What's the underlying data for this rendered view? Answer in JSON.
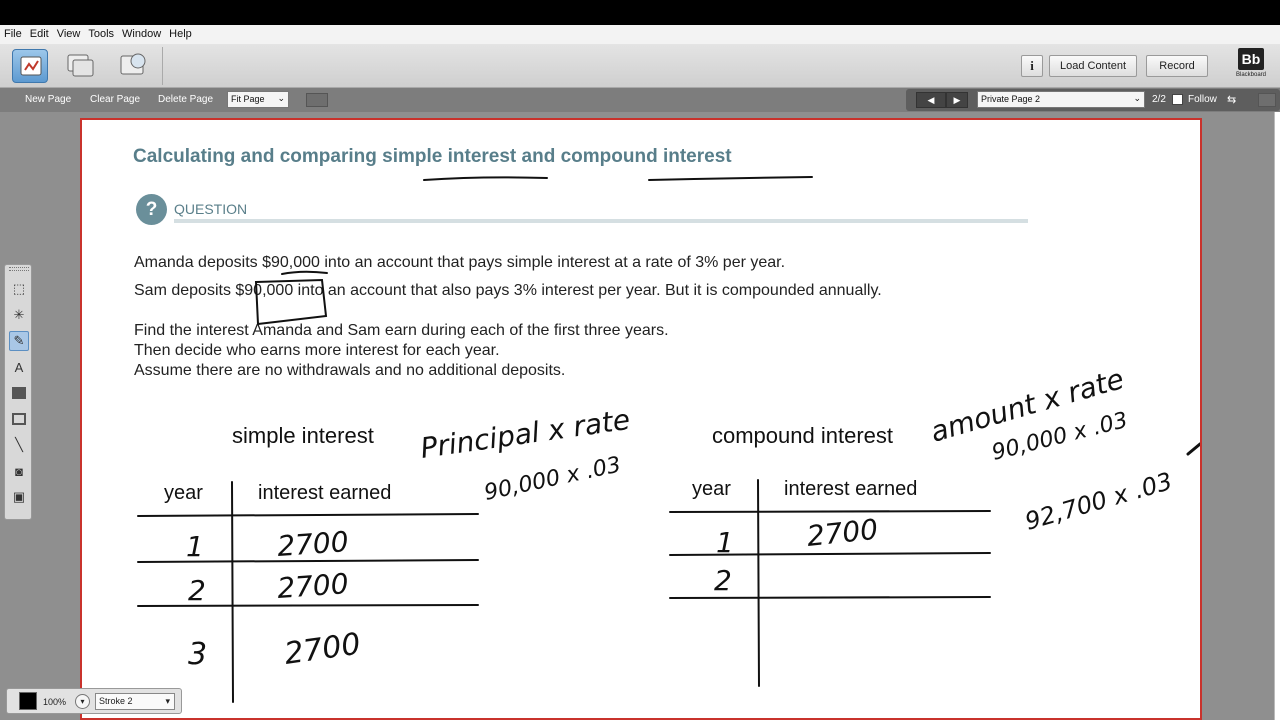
{
  "menu": [
    "File",
    "Edit",
    "View",
    "Tools",
    "Window",
    "Help"
  ],
  "toolbar": {
    "info_label": "i",
    "load_content": "Load Content",
    "record": "Record",
    "logo_text": "Bb",
    "logo_sub": "Blackboard"
  },
  "subbar": {
    "new_page": "New Page",
    "clear_page": "Clear Page",
    "delete_page": "Delete Page",
    "fit_page": "Fit Page",
    "page_select": "Private Page 2",
    "page_count": "2/2",
    "follow": "Follow"
  },
  "canvas": {
    "title": "Calculating and comparing simple interest and compound interest",
    "question_mark": "?",
    "question_label": "QUESTION",
    "line1": "Amanda deposits $90,000 into an account that pays simple interest at a rate of 3% per year.",
    "line2": "Sam deposits $90,000 into an account that also pays 3% interest per year. But it is compounded annually.",
    "line3": "Find the interest Amanda and Sam earn during each of the first three years.",
    "line4": "Then decide who earns more interest for each year.",
    "line5": "Assume there are no withdrawals and no additional deposits.",
    "simple_title": "simple interest",
    "compound_title": "compound interest",
    "col_year": "year",
    "col_interest": "interest earned",
    "handwriting": {
      "principal_rate": "Principal x rate",
      "calc_simple": "90,000 x .03",
      "amount_rate": "amount x rate",
      "calc_compound1": "90,000 x .03",
      "calc_compound2": "92,700 x .03",
      "simple_rows": [
        [
          "1",
          "2700"
        ],
        [
          "2",
          "2700"
        ],
        [
          "3",
          "2700"
        ]
      ],
      "compound_rows": [
        [
          "1",
          "2700"
        ],
        [
          "2",
          ""
        ]
      ]
    }
  },
  "bottom": {
    "zoom": "100%",
    "stroke": "Stroke 2"
  },
  "colors": {
    "title": "#587e8a",
    "frame": "#c9322c",
    "ink": "#111111"
  }
}
